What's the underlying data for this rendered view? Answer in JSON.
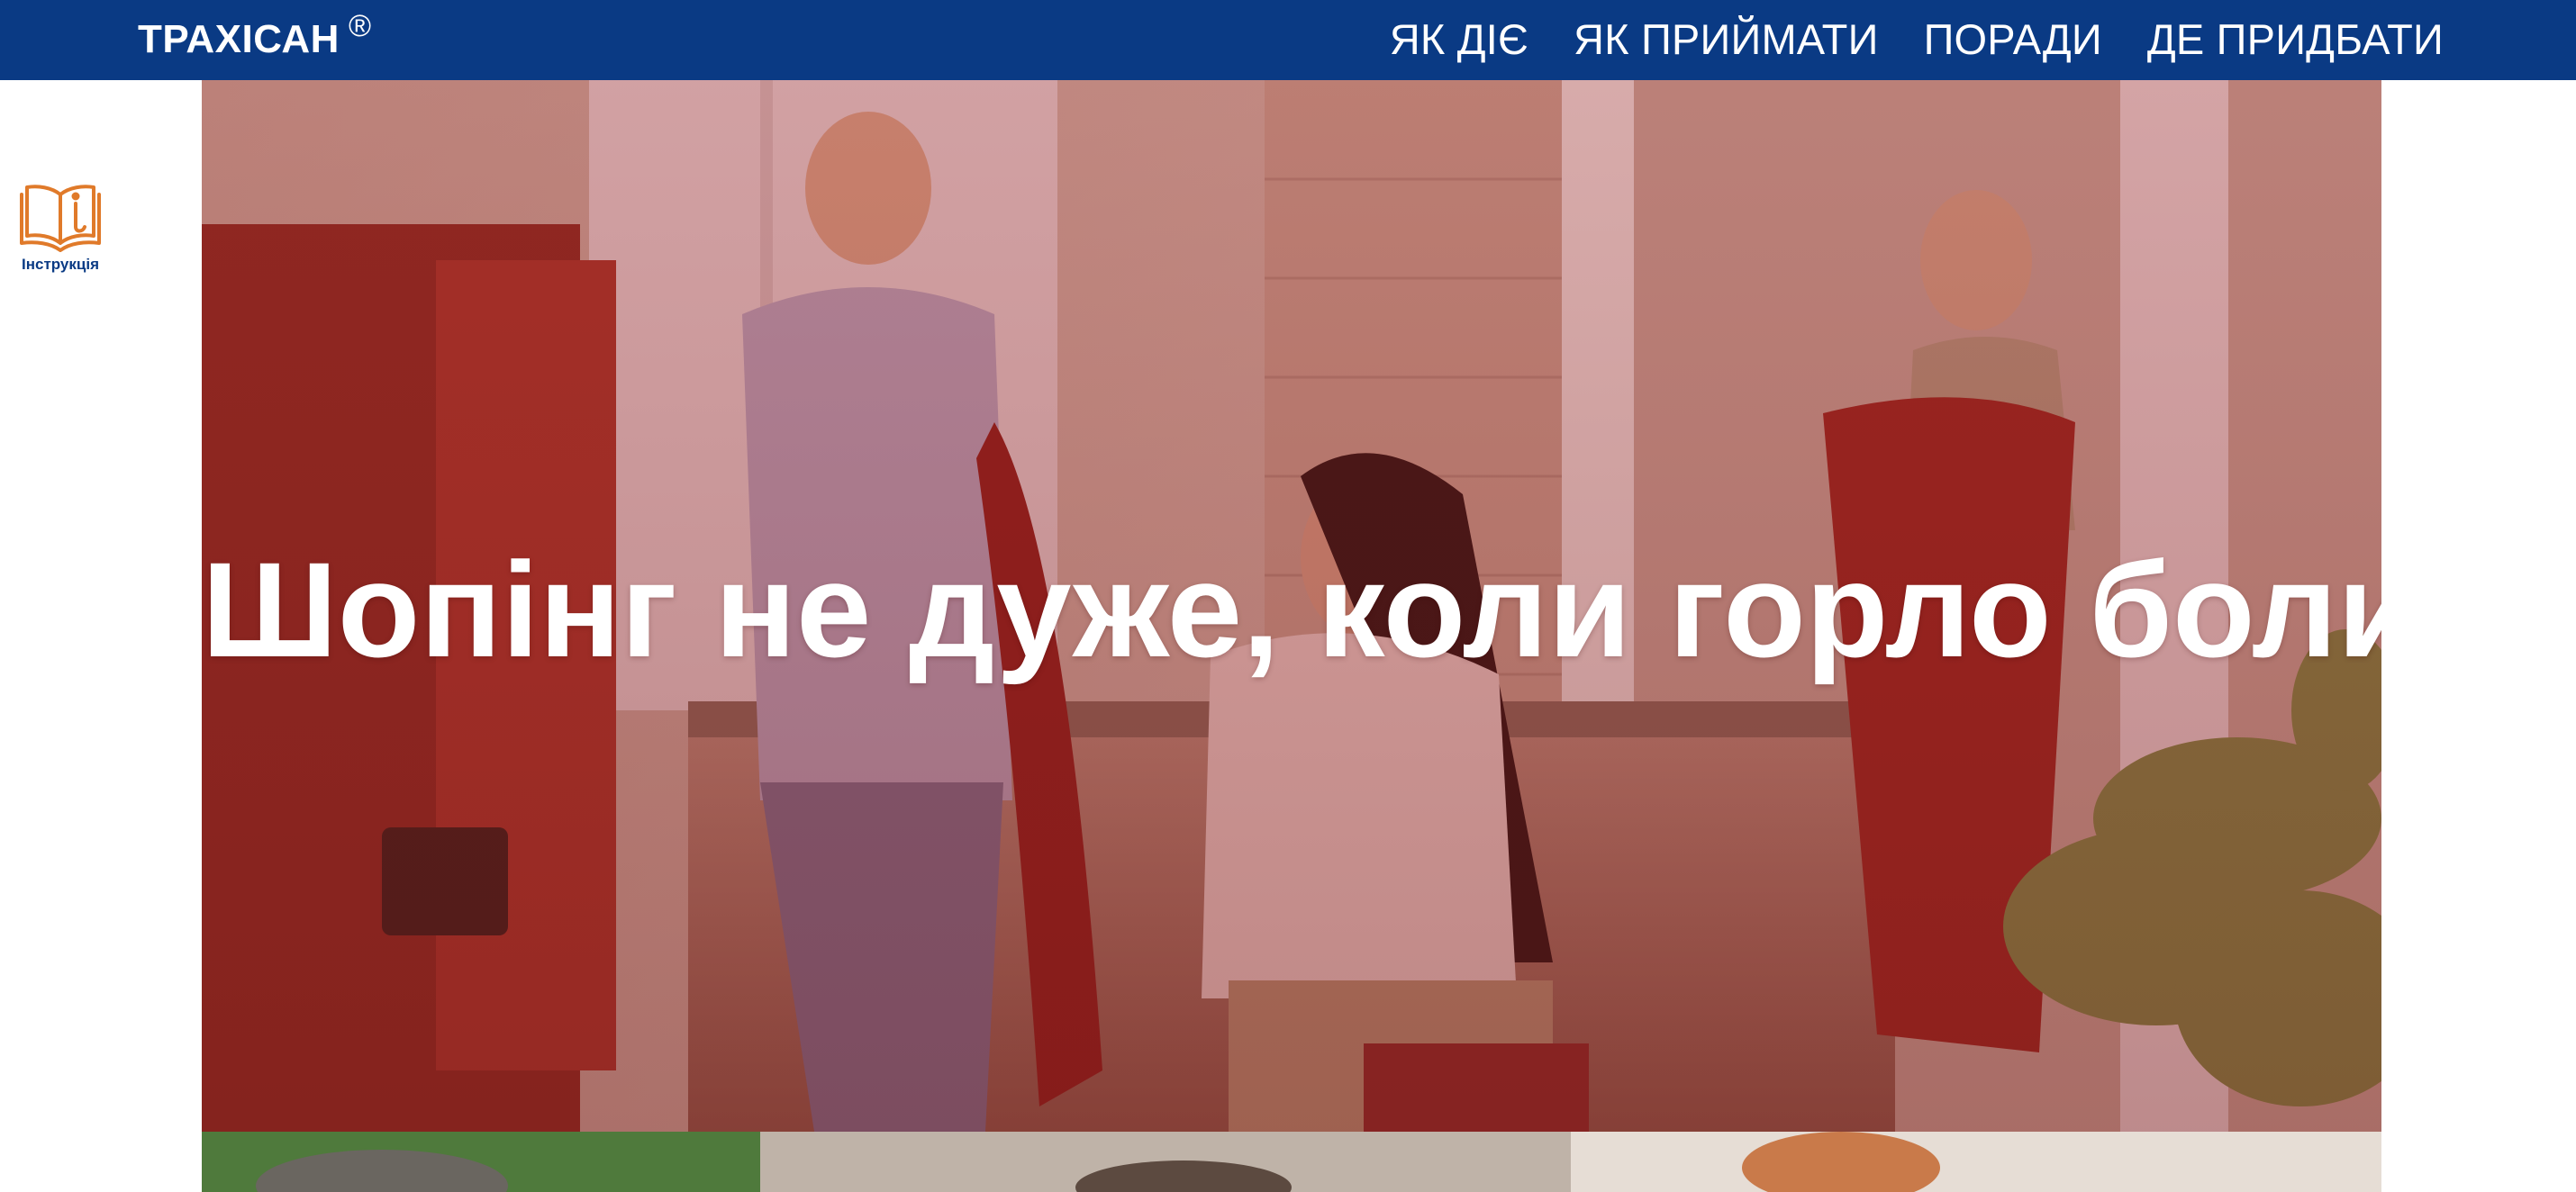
{
  "header": {
    "brand": "ТРАХІСАН",
    "brand_mark": "®",
    "nav": [
      {
        "label": "ЯК ДІЄ"
      },
      {
        "label": "ЯК ПРИЙМАТИ"
      },
      {
        "label": "ПОРАДИ"
      },
      {
        "label": "ДЕ ПРИДБАТИ"
      }
    ],
    "bg_color": "#0a3a84"
  },
  "sidebar": {
    "instruction": {
      "icon": "book-icon",
      "label": "Інструкція",
      "icon_color": "#e07a2a"
    }
  },
  "hero": {
    "title": "Шопінг не дуже, коли горло болить",
    "overlay_color": "#9a2020"
  }
}
